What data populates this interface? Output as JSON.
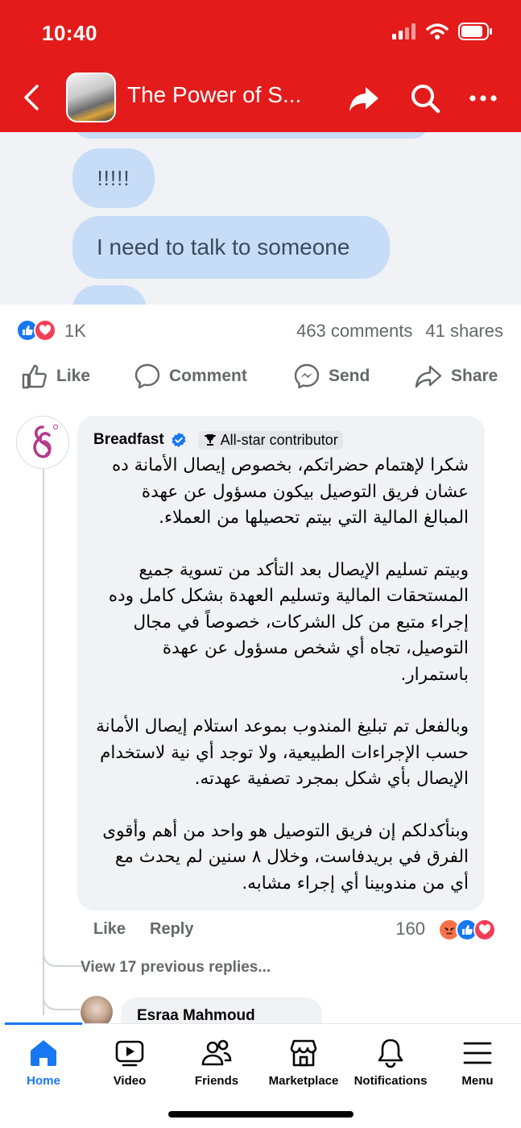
{
  "status_bar": {
    "time": "10:40"
  },
  "header": {
    "title": "The Power of S...",
    "icons": [
      "back-chevron-icon",
      "share-icon",
      "search-icon",
      "more-icon"
    ]
  },
  "post_image": {
    "bubbles": [
      "!!!!!",
      "I need to talk to someone"
    ]
  },
  "post_stats": {
    "reaction_count": "1K",
    "comments": "463 comments",
    "shares": "41 shares"
  },
  "actions": {
    "like": "Like",
    "comment": "Comment",
    "send": "Send",
    "share": "Share"
  },
  "comment": {
    "author": "Breadfast",
    "badge": "All-star contributor",
    "paragraphs": [
      "شكرا لإهتمام حضراتكم، بخصوص إيصال الأمانة ده عشان فريق التوصيل بيكون مسؤول عن عهدة المبالغ المالية التي بيتم تحصيلها من العملاء.",
      "وبيتم تسليم الإيصال بعد التأكد من تسوية جميع المستحقات المالية وتسليم العهدة بشكل كامل وده إجراء متبع من كل الشركات، خصوصاً في مجال التوصيل، تجاه أي شخص مسؤول عن عهدة باستمرار.",
      "وبالفعل تم تبليغ المندوب بموعد استلام إيصال الأمانة حسب الإجراءات الطبيعية، ولا توجد أي نية لاستخدام الإيصال بأي شكل بمجرد تصفية عهدته.",
      "وبنأكدلكم إن فريق التوصيل هو واحد من أهم وأقوى الفرق في بريدفاست، وخلال ٨ سنين لم يحدث مع أي من مندوبينا أي إجراء مشابه."
    ],
    "like_label": "Like",
    "reply_label": "Reply",
    "reaction_count": "160"
  },
  "view_previous": "View 17 previous replies...",
  "reply": {
    "author": "Esraa Mahmoud"
  },
  "bottom_nav": {
    "items": [
      {
        "label": "Home",
        "icon": "home-icon",
        "active": true
      },
      {
        "label": "Video",
        "icon": "video-icon"
      },
      {
        "label": "Friends",
        "icon": "friends-icon"
      },
      {
        "label": "Marketplace",
        "icon": "marketplace-icon"
      },
      {
        "label": "Notifications",
        "icon": "bell-icon"
      },
      {
        "label": "Menu",
        "icon": "menu-icon"
      }
    ]
  },
  "colors": {
    "header_red": "#e31b1b",
    "facebook_blue": "#1877f2",
    "bubble_blue": "#c7dcf7",
    "muted_text": "#65676b",
    "comment_bg": "#f0f2f5"
  }
}
